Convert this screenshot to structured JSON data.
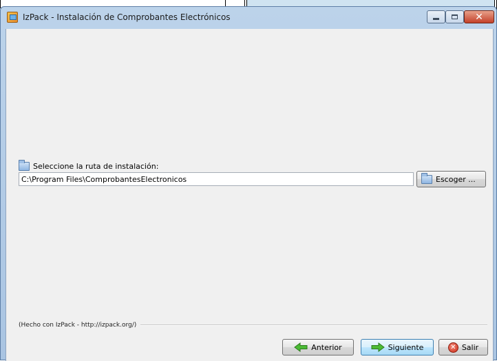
{
  "window": {
    "title": "IzPack - Instalación de Comprobantes Electrónicos"
  },
  "controls": {
    "minimize_icon": "minimize-icon",
    "maximize_icon": "maximize-icon",
    "close_icon": "close-icon",
    "close_glyph": "✕"
  },
  "target": {
    "label": "Seleccione la ruta de instalación:",
    "path_value": "C:\\Program Files\\ComprobantesElectronicos",
    "browse_label": "Escoger ..."
  },
  "footer": {
    "credit": "(Hecho con IzPack - http://izpack.org/)"
  },
  "nav": {
    "previous_label": "Anterior",
    "next_label": "Siguiente",
    "exit_label": "Salir",
    "exit_glyph": "✕"
  },
  "colors": {
    "arrow_green": "#3fae2a",
    "exit_red": "#cc2a16",
    "primary_button": "#bee6fd"
  }
}
